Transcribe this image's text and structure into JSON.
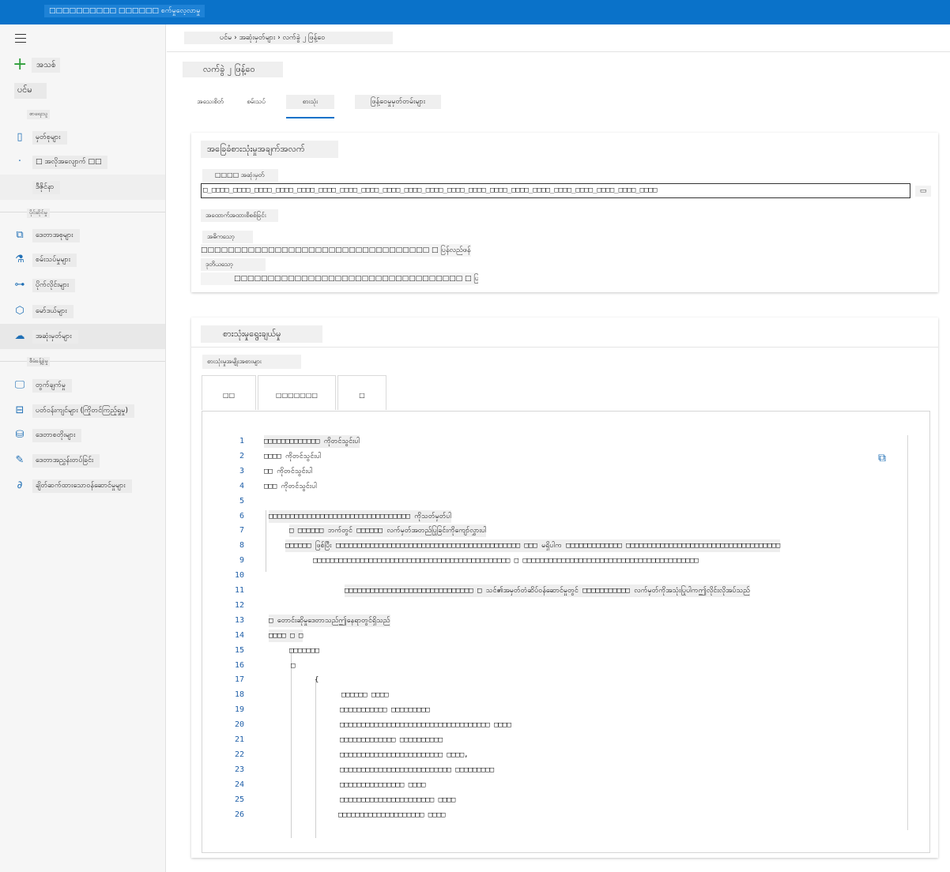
{
  "app": {
    "title": "□□□□□□□□□□ □□□□□□ စက်မှုလေ့လာမှု"
  },
  "sidebar": {
    "new_label": "အသစ်",
    "home_label": "ပင်မ",
    "section_author": "စာရေးသူ",
    "section_assets": "ပိုင်ဆိုင်မှု",
    "section_manage": "စီမံခန့်ခွဲမှု",
    "items": [
      {
        "label": "မှတ်စုများ",
        "icon": "notebook-icon"
      },
      {
        "label": "□ အလိုအလျောက် □□",
        "icon": "automl-icon"
      },
      {
        "label": "ဒီဇိုင်နာ",
        "icon": "designer-icon"
      },
      {
        "label": "ဒေတာအစုများ",
        "icon": "datasets-icon"
      },
      {
        "label": "စမ်းသပ်မှုများ",
        "icon": "flask-icon"
      },
      {
        "label": "ပိုက်လိုင်းများ",
        "icon": "pipeline-icon"
      },
      {
        "label": "မော်ဒယ်များ",
        "icon": "cube-icon"
      },
      {
        "label": "အဆုံးမှတ်များ",
        "icon": "endpoint-icon"
      },
      {
        "label": "တွက်ချက်မှု",
        "icon": "compute-icon"
      },
      {
        "label": "ပတ်ဝန်းကျင်များ (ကြိုတင်ကြည့်ရှုမှု)",
        "icon": "environment-icon"
      },
      {
        "label": "ဒေတာစတိုးများ",
        "icon": "datastore-icon"
      },
      {
        "label": "ဒေတာအညွှန်းတပ်ခြင်း",
        "icon": "labeling-icon"
      },
      {
        "label": "ချိတ်ဆက်ထားသောဝန်ဆောင်မှုများ",
        "icon": "linked-services-icon"
      }
    ]
  },
  "breadcrumb": "ပင်မ  ›  အဆုံးမှတ်များ  ›  လက်ခွဲ ၂ ဖြန့်ဝေ",
  "page_title": "လက်ခွဲ ၂ ဖြန့်ဝေ",
  "tabs": [
    "အသေးစိတ်",
    "စမ်းသပ်",
    "စားသုံး",
    "ဖြန့်ဝေမှုမှတ်တမ်းများ"
  ],
  "selected_tab": "စားသုံး",
  "basic_info": {
    "header": "အခြေခံစားသုံးမှုအချက်အလက်",
    "rest_label": "□□□□ အဆုံးမှတ်",
    "rest_value": "□_□□□□_□□□□_□□□□_□□□□_□□□□_□□□□_□□□□_□□□□_□□□□_□□□□_□□□□_□□□□_□□□□_□□□□_□□□□_□□□□_□□□□_□□□□_□□□□_□□□□_□□□□",
    "auth_label": "အထောက်အထားစိစစ်ခြင်း",
    "primary_label": "အဓိကသော့",
    "primary_value": "□□□□□□□□□□□□□□□□□□□□□□□□□□□□□□□□□□ □ ပြန်လည်ဖန်တီးပါ",
    "secondary_label": "ဒုတိယသော့",
    "secondary_value": "□□□□□□□□□□□□□□□□□□□□□□□□□□□□□□□□□□ □ ပြန်လည်ဖန်တီးပါ"
  },
  "consumption": {
    "header": "စားသုံးမှုရွေးချယ်မှု",
    "types_label": "စားသုံးမှုအမျိုးအစားများ",
    "lang_tabs": [
      "□□",
      "□□□□□□□",
      "□"
    ],
    "code_lines": [
      {
        "n": "1",
        "text": "□□□□□□□□□□□□□ ကိုတင်သွင်းပါ"
      },
      {
        "n": "2",
        "text": "□□□□ ကိုတင်သွင်းပါ"
      },
      {
        "n": "3",
        "text": "□□ ကိုတင်သွင်းပါ"
      },
      {
        "n": "4",
        "text": "□□□ ကိုတင်သွင်းပါ"
      },
      {
        "n": "5",
        "text": ""
      },
      {
        "n": "6",
        "text": "□□□□□□□□□□□□□□□□□□□□□□□□□□□□□□□□□ ကိုသတ်မှတ်ပါ"
      },
      {
        "n": "7",
        "text": "□ □□□□□□ ဘက်တွင် □□□□□□ လက်မှတ်အတည်ပြုခြင်းကိုကျော်လွှားပါ"
      },
      {
        "n": "8",
        "text": "□□□□□□ ဖြစ်ပြီး □□□□□□□□□□□□□□□□□□□□□□□□□□□□□□□□□□□□□□□□□□□ □□□ မရှိပါက □□□□□□□□□□□□□ □□□□□□□□□□□□□□□□□□□□□□□□□□□□□□□□□□□□"
      },
      {
        "n": "9",
        "text": "□□□□□□□□□□□□□□□□□□□□□□□□□□□□□□□□□□□□□□□□□□□□□□ □ □□□□□□□□□□□□□□□□□□□□□□□□□□□□□□□□□□□□□□□□□"
      },
      {
        "n": "10",
        "text": ""
      },
      {
        "n": "11",
        "text": "□□□□□□□□□□□□□□□□□□□□□□□□□□□□□□ □ သင်၏အမှတ်တံဆိပ်ဝန်ဆောင်မှုတွင် □□□□□□□□□□□ လက်မှတ်ကိုအသုံးပြုပါကဤလိုင်းလိုအပ်သည်"
      },
      {
        "n": "12",
        "text": ""
      },
      {
        "n": "13",
        "text": "□ တောင်းဆိုမှုဒေတာသည်ဤနေရာတွင်ရှိသည်"
      },
      {
        "n": "14",
        "text": "□□□□ □ □"
      },
      {
        "n": "15",
        "text": "□□□□□□□"
      },
      {
        "n": "16",
        "text": "□"
      },
      {
        "n": "17",
        "text": "{"
      },
      {
        "n": "18",
        "text": "□□□□□□ □□□□"
      },
      {
        "n": "19",
        "text": "□□□□□□□□□□□ □□□□□□□□□"
      },
      {
        "n": "20",
        "text": "□□□□□□□□□□□□□□□□□□□□□□□□□□□□□□□□□□□ □□□□"
      },
      {
        "n": "21",
        "text": "□□□□□□□□□□□□□ □□□□□□□□□□"
      },
      {
        "n": "22",
        "text": "□□□□□□□□□□□□□□□□□□□□□□□□ □□□□,"
      },
      {
        "n": "23",
        "text": "□□□□□□□□□□□□□□□□□□□□□□□□□□ □□□□□□□□□"
      },
      {
        "n": "24",
        "text": "□□□□□□□□□□□□□□□ □□□□"
      },
      {
        "n": "25",
        "text": "□□□□□□□□□□□□□□□□□□□□□□ □□□□"
      },
      {
        "n": "26",
        "text": "□□□□□□□□□□□□□□□□□□□□ □□□□"
      }
    ]
  },
  "accent": "#0a72c9",
  "code_line_number_color": "#1f5fa8"
}
